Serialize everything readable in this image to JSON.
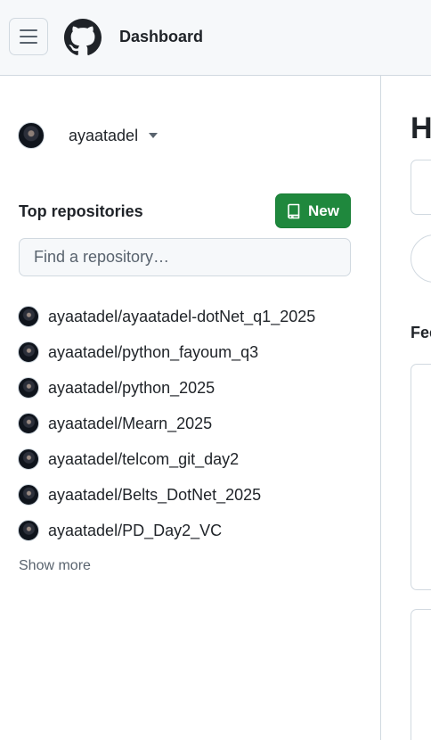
{
  "header": {
    "title": "Dashboard",
    "menu_icon": "hamburger-icon",
    "logo_icon": "github-mark-icon"
  },
  "sidebar": {
    "context": {
      "username": "ayaatadel"
    },
    "top_repositories": {
      "title": "Top repositories",
      "new_button_label": "New",
      "search_placeholder": "Find a repository…",
      "repos": [
        "ayaatadel/ayaatadel-dotNet_q1_2025",
        "ayaatadel/python_fayoum_q3",
        "ayaatadel/python_2025",
        "ayaatadel/Mearn_2025",
        "ayaatadel/telcom_git_day2",
        "ayaatadel/Belts_DotNet_2025",
        "ayaatadel/PD_Day2_VC"
      ],
      "show_more_label": "Show more"
    }
  },
  "main": {
    "heading": "H",
    "feed_label": "Fee"
  },
  "colors": {
    "primary_button": "#1f883d",
    "header_bg": "#f6f8fa",
    "border": "#d1d9e0",
    "muted_text": "#59636e"
  }
}
